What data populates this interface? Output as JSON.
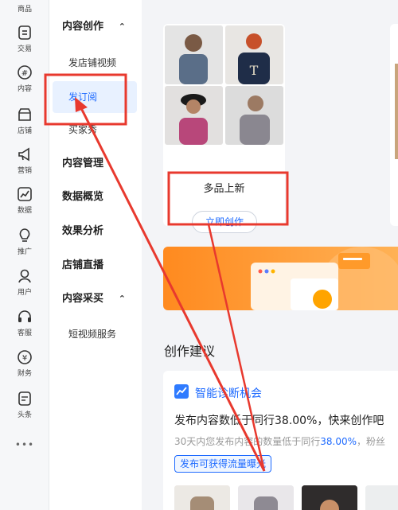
{
  "rail": [
    {
      "label": "商品",
      "icon": "product-icon"
    },
    {
      "label": "交易",
      "icon": "trade-icon"
    },
    {
      "label": "内容",
      "icon": "hash-icon"
    },
    {
      "label": "店铺",
      "icon": "shop-icon"
    },
    {
      "label": "营销",
      "icon": "megaphone-icon"
    },
    {
      "label": "数据",
      "icon": "chart-icon"
    },
    {
      "label": "推广",
      "icon": "bulb-icon"
    },
    {
      "label": "用户",
      "icon": "user-icon"
    },
    {
      "label": "客服",
      "icon": "headset-icon"
    },
    {
      "label": "财务",
      "icon": "yen-icon"
    },
    {
      "label": "头条",
      "icon": "news-icon"
    },
    {
      "label": "•••",
      "icon": "more-icon"
    }
  ],
  "menu": {
    "group_content_creation": "内容创作",
    "item_store_video": "发店铺视频",
    "item_subscribe": "发订阅",
    "item_buyer_show": "买家秀",
    "group_content_manage": "内容管理",
    "group_data_overview": "数据概览",
    "group_effect_analysis": "效果分析",
    "group_store_live": "店铺直播",
    "group_content_purchase": "内容采买",
    "item_short_video_service": "短视频服务"
  },
  "card": {
    "title": "多品上新",
    "button": "立即创作"
  },
  "section": {
    "title": "创作建议"
  },
  "diagnosis": {
    "title": "智能诊断机会",
    "main_text": "发布内容数低于同行38.00%，快来创作吧",
    "sub_prefix": "30天内您发布内容的数量低于同行",
    "sub_value": "38.00%",
    "sub_suffix": "，粉丝",
    "tag": "发布可获得流量曝光"
  },
  "colors": {
    "accent": "#1f6bff",
    "annotation_red": "#e8392e",
    "banner_orange": "#ff8a1f"
  }
}
